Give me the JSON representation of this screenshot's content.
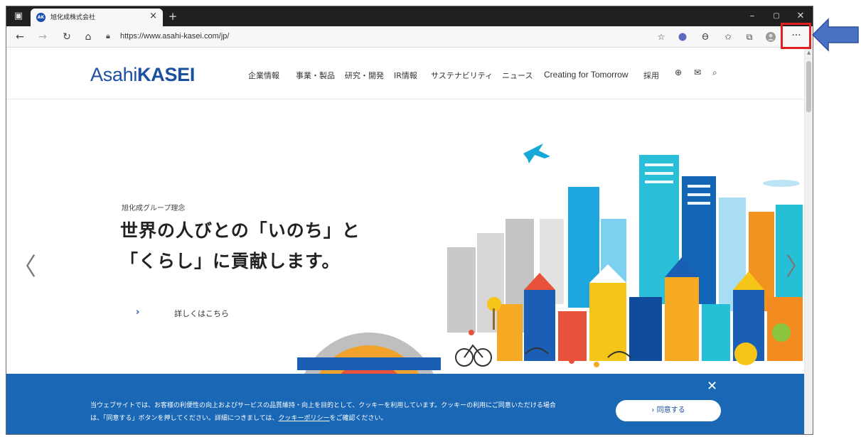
{
  "browser": {
    "tab_title": "旭化成株式会社",
    "tab_favicon_text": "AK",
    "url": "https://www.asahi-kasei.com/jp/",
    "new_tab": "+",
    "tab_close": "×",
    "window_controls": {
      "minimize": "–",
      "maximize": "▢",
      "close": "✕"
    },
    "toolbar_icons": [
      "back-icon",
      "forward-icon",
      "refresh-icon",
      "home-icon",
      "lock-icon",
      "add-favorite-icon",
      "extension-icon",
      "read-aloud-icon",
      "favorites-icon",
      "collections-icon",
      "profile-icon",
      "more-icon"
    ],
    "more_label": "···"
  },
  "site": {
    "logo_regular": "Asahi",
    "logo_bold": "KASEI",
    "nav": [
      "企業情報",
      "事業・製品",
      "研究・開発",
      "IR情報",
      "サステナビリティ",
      "ニュース",
      "Creating for Tomorrow",
      "採用"
    ],
    "nav_icons": [
      "globe-icon",
      "mail-icon",
      "search-icon"
    ],
    "brand_color": "#1b4fa0"
  },
  "hero": {
    "label": "旭化成グループ理念",
    "line1": "世界の人びとの「いのち」と",
    "line2": "「くらし」に貢献します。",
    "link": "詳しくはこちら",
    "prev": "〈",
    "next": "〉"
  },
  "cookie": {
    "text1": "当ウェブサイトでは、お客様の利便性の向上およびサービスの品質維持・向上を目的として、クッキーを利用しています。クッキーの利用にご同意いただける場合",
    "text2_before": "は、「同意する」ボタンを押してください。詳細につきましては、",
    "text2_link": "クッキーポリシー",
    "text2_after": "をご確認ください。",
    "button": "› 同意する",
    "close": "✕",
    "background": "#1967b5"
  },
  "annotation": {
    "highlight_color": "#e02020",
    "arrow_color": "#4a72c4"
  }
}
